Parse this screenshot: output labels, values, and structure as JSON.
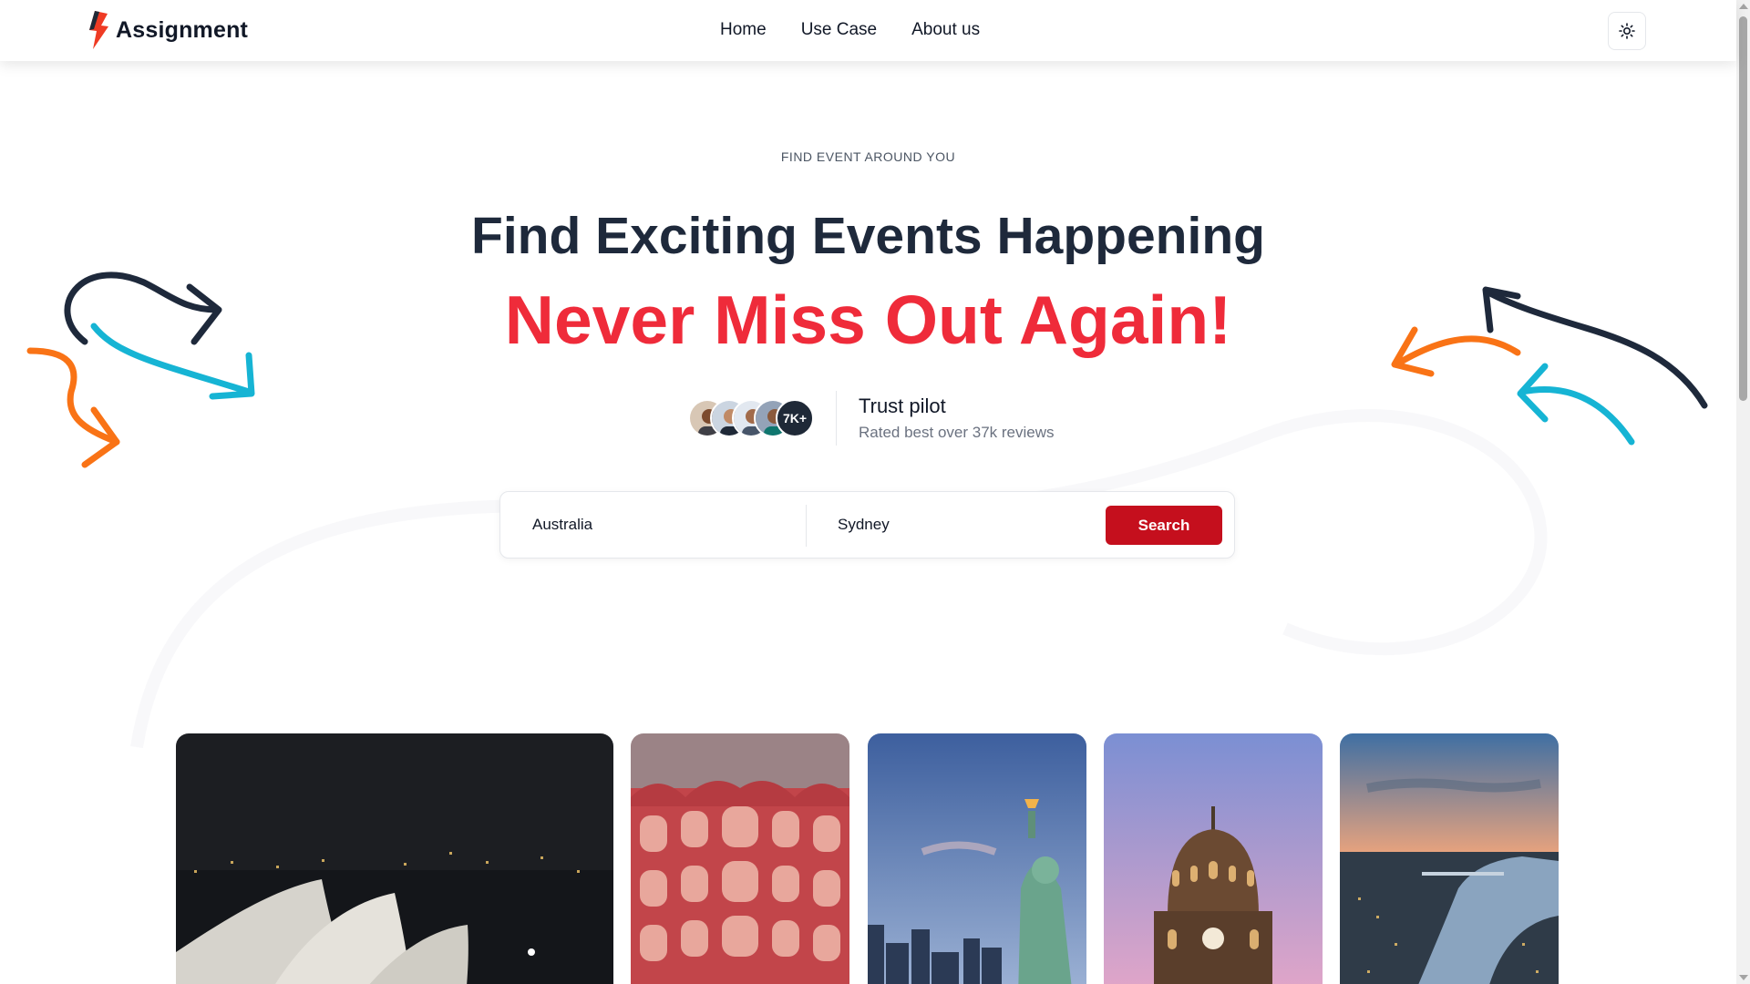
{
  "header": {
    "brand": "Assignment",
    "nav": [
      {
        "label": "Home"
      },
      {
        "label": "Use Case"
      },
      {
        "label": "About us"
      }
    ],
    "theme_toggle_icon": "sun-icon"
  },
  "hero": {
    "eyebrow": "FIND EVENT AROUND YOU",
    "title_line1": "Find Exciting Events Happening",
    "title_line2": "Never Miss Out Again!",
    "accent_color": "#ef2b3a"
  },
  "trust": {
    "count_badge": "7K+",
    "title": "Trust pilot",
    "subtitle": "Rated best over 37k reviews"
  },
  "search": {
    "country_value": "Australia",
    "city_value": "Sydney",
    "button_label": "Search",
    "button_color": "#c50f1d"
  },
  "gallery": {
    "cards": [
      "sydney-opera-house",
      "hawa-mahal",
      "statue-of-liberty",
      "chhatrapati-shivaji-terminus",
      "london-thames"
    ]
  }
}
